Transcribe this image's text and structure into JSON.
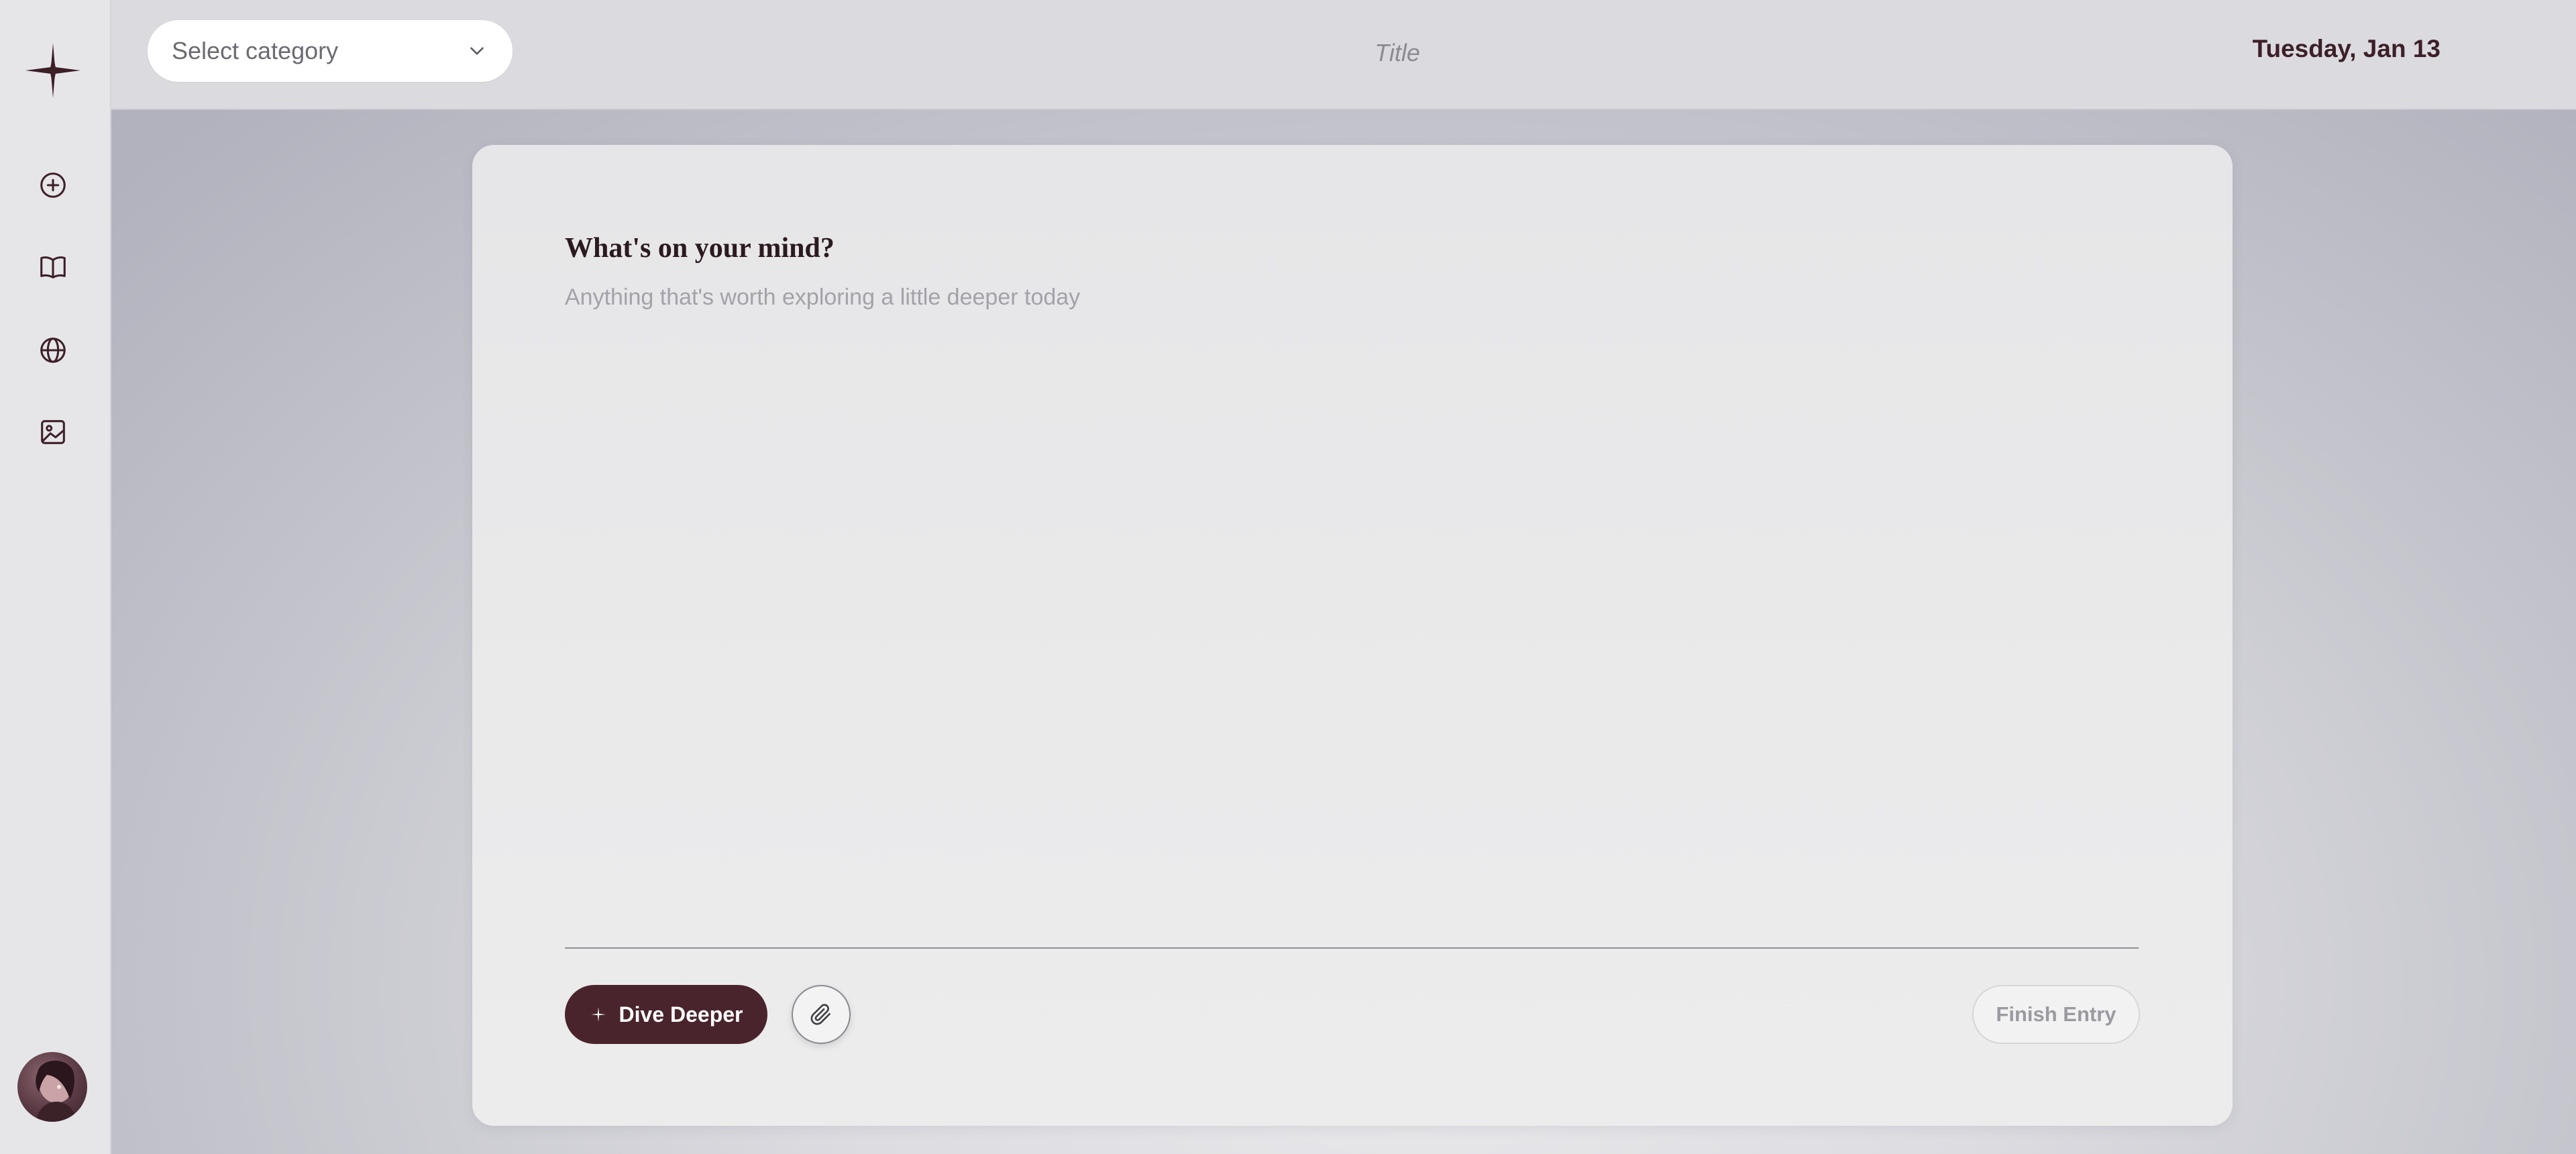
{
  "sidebar": {
    "logo": "sparkle-star-logo",
    "items": [
      {
        "icon": "plus-circle-icon",
        "tooltip": ""
      },
      {
        "icon": "book-open-icon",
        "tooltip": ""
      },
      {
        "icon": "globe-icon",
        "tooltip": ""
      },
      {
        "icon": "image-icon",
        "tooltip": ""
      }
    ],
    "avatar": "user-avatar"
  },
  "topbar": {
    "category_placeholder": "Select category",
    "title_placeholder": "Title",
    "date": "Tuesday, Jan 13"
  },
  "editor": {
    "prompt": "What's on your mind?",
    "body_placeholder": "Anything that's worth exploring a little deeper today",
    "dive_label": "Dive Deeper",
    "finish_label": "Finish Entry"
  },
  "colors": {
    "accent": "#4a242d",
    "date_text": "#3d1f27",
    "sidebar_bg": "#e6e6e9",
    "topbar_bg": "#dadadf",
    "card_bg": "#e8e8ea"
  }
}
